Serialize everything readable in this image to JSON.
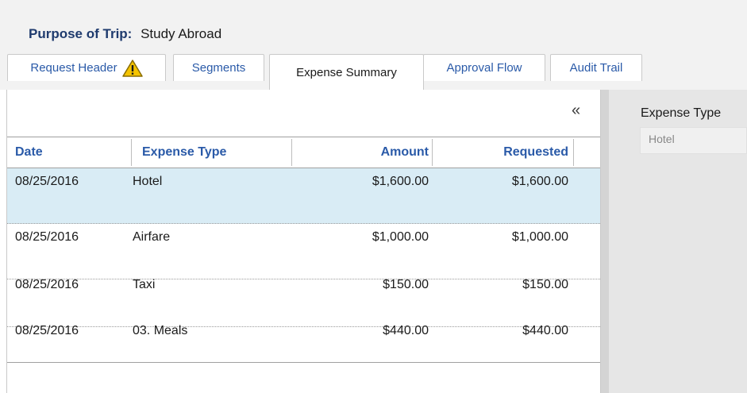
{
  "purpose": {
    "label": "Purpose of Trip:",
    "value": "Study Abroad"
  },
  "tabs": [
    {
      "label": "Request Header",
      "has_warning": true
    },
    {
      "label": "Segments"
    },
    {
      "label": "Expense Summary",
      "active": true
    },
    {
      "label": "Approval Flow"
    },
    {
      "label": "Audit Trail"
    }
  ],
  "collapse_symbol": "«",
  "table": {
    "columns": [
      "Date",
      "Expense Type",
      "Amount",
      "Requested"
    ],
    "rows": [
      {
        "date": "08/25/2016",
        "type": "Hotel",
        "amount": "$1,600.00",
        "requested": "$1,600.00",
        "selected": true
      },
      {
        "date": "08/25/2016",
        "type": "Airfare",
        "amount": "$1,000.00",
        "requested": "$1,000.00"
      },
      {
        "date": "08/25/2016",
        "type": "Taxi",
        "amount": "$150.00",
        "requested": "$150.00"
      },
      {
        "date": "08/25/2016",
        "type": "03. Meals",
        "amount": "$440.00",
        "requested": "$440.00"
      }
    ]
  },
  "detail": {
    "expense_type_label": "Expense Type",
    "expense_type_value": "Hotel"
  },
  "colors": {
    "link_blue": "#2a5aa8",
    "selected_row": "#d9ecf5",
    "warning_yellow": "#f5c400"
  },
  "icons": {
    "warning": "warning-icon",
    "collapse": "collapse-left-icon"
  }
}
